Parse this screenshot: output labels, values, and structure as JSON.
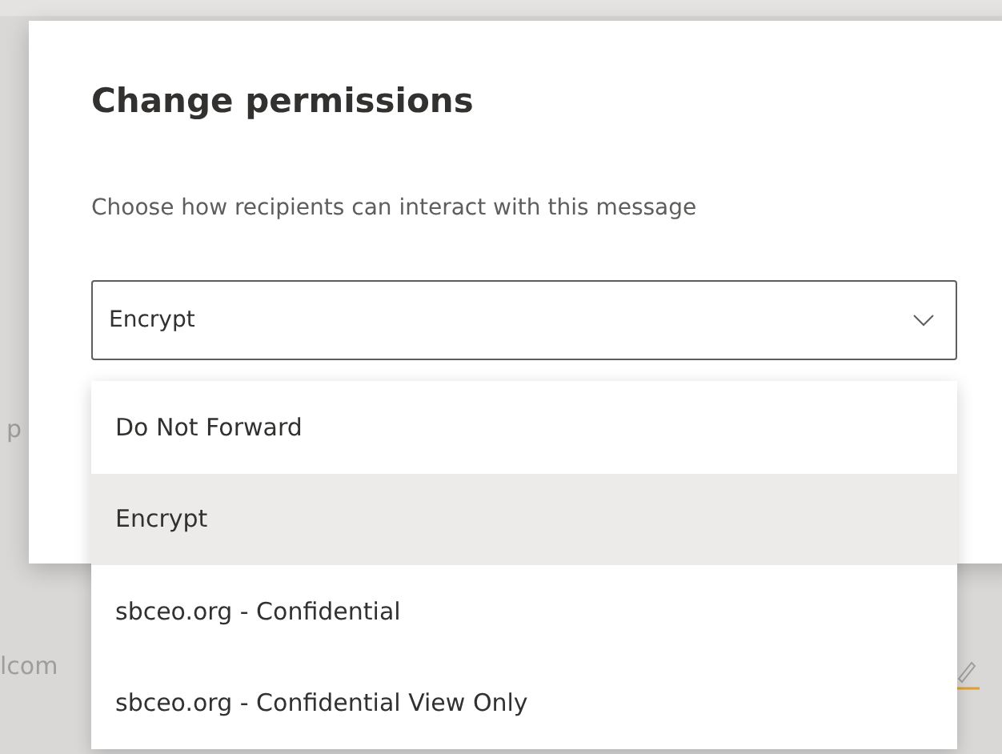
{
  "background": {
    "fragments": [
      "p",
      "lcom"
    ]
  },
  "dialog": {
    "title": "Change permissions",
    "description": "Choose how recipients can interact with this message",
    "dropdown": {
      "value": "Encrypt",
      "expanded": true,
      "options": [
        {
          "label": "Do Not Forward",
          "selected": false
        },
        {
          "label": "Encrypt",
          "selected": true
        },
        {
          "label": "sbceo.org - Confidential",
          "selected": false
        },
        {
          "label": "sbceo.org - Confidential View Only",
          "selected": false
        }
      ]
    }
  }
}
